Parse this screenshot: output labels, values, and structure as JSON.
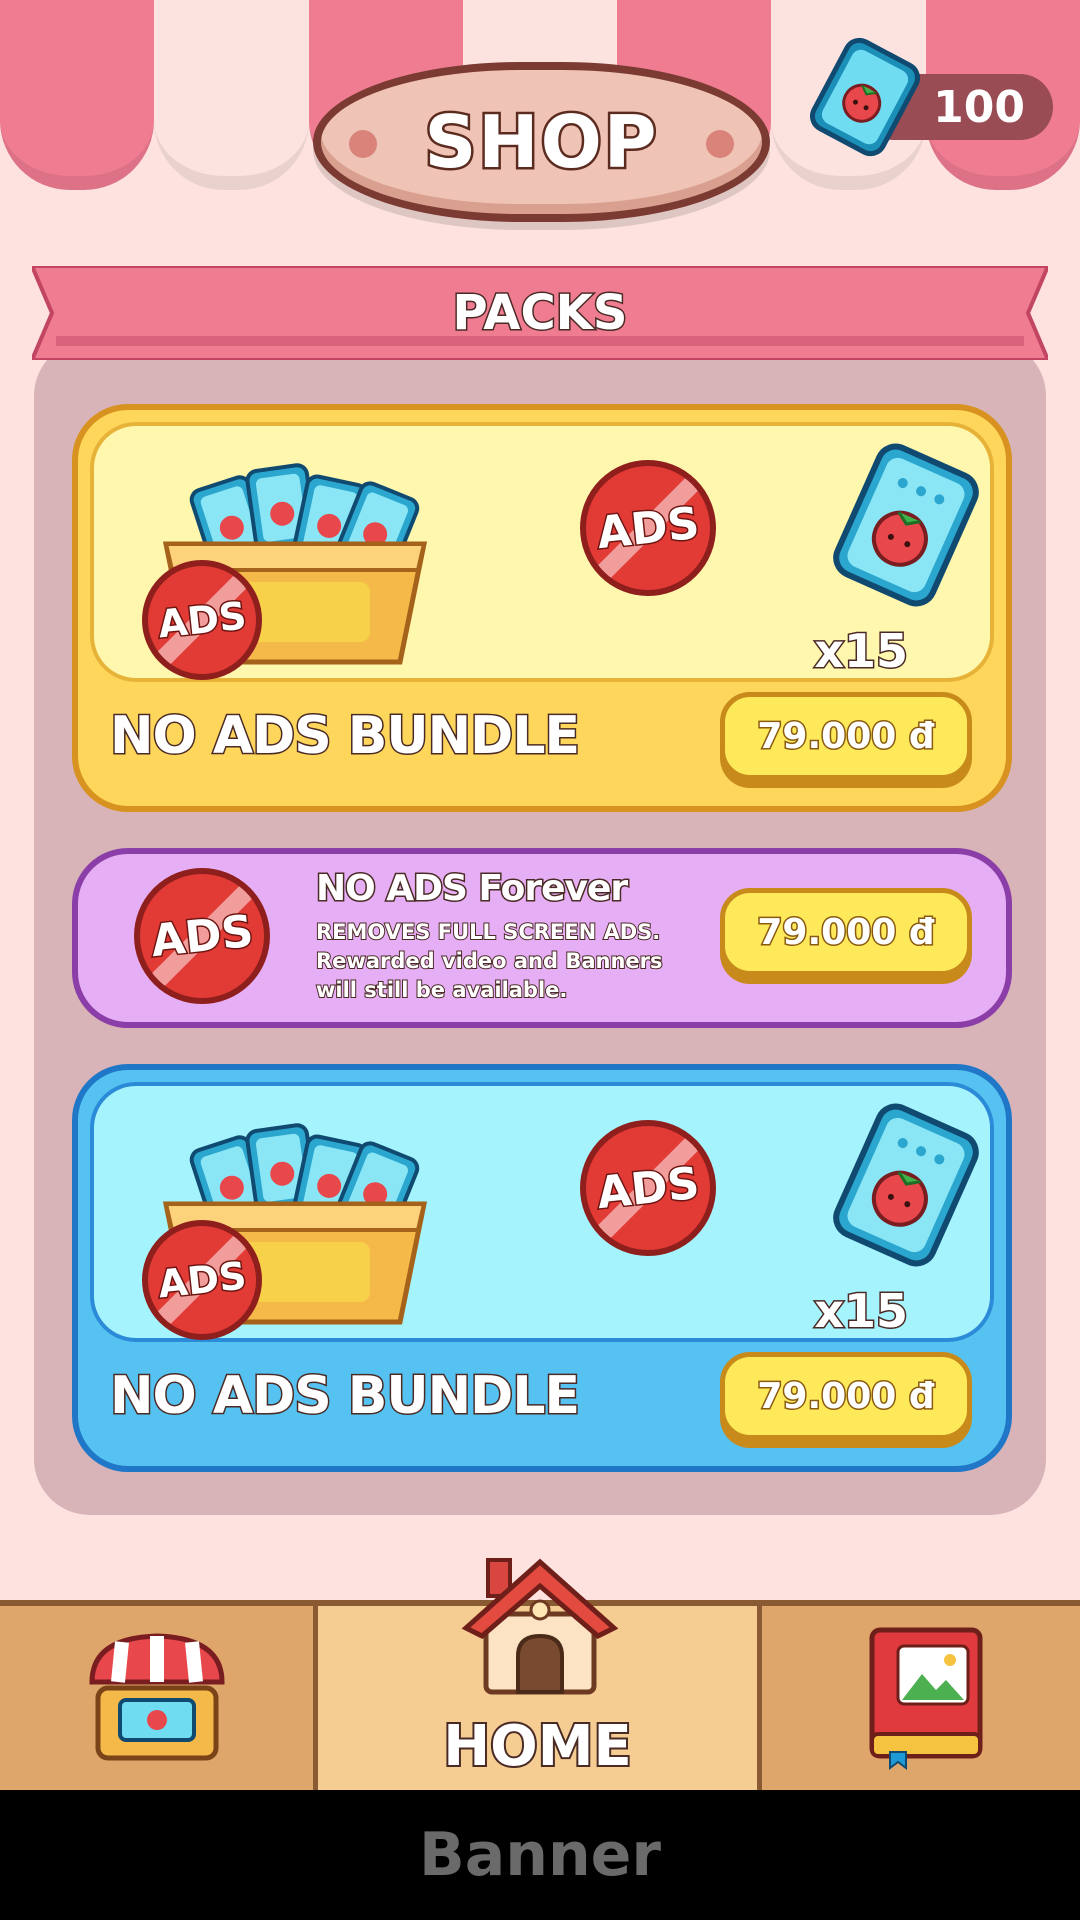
{
  "header": {
    "title": "SHOP",
    "currency_icon": "ticket-icon",
    "currency_value": "100"
  },
  "section": {
    "title": "PACKS"
  },
  "packs": [
    {
      "name": "NO ADS BUNDLE",
      "price": "79.000 đ",
      "quantity": "x15",
      "badge": "ADS",
      "color": "#fed65c"
    },
    {
      "name": "NO ADS Forever",
      "desc_line1": "REMOVES FULL SCREEN ADS.",
      "desc_line2": "Rewarded video and Banners",
      "desc_line3": "will still be available.",
      "price": "79.000 đ",
      "badge": "ADS",
      "color": "#e6aef5"
    },
    {
      "name": "NO ADS BUNDLE",
      "price": "79.000 đ",
      "quantity": "x15",
      "badge": "ADS",
      "color": "#56c2f1"
    }
  ],
  "nav": {
    "items": [
      {
        "icon": "shop-icon"
      },
      {
        "icon": "house-icon",
        "label": "HOME"
      },
      {
        "icon": "album-book-icon"
      }
    ]
  },
  "banner": {
    "label": "Banner"
  }
}
